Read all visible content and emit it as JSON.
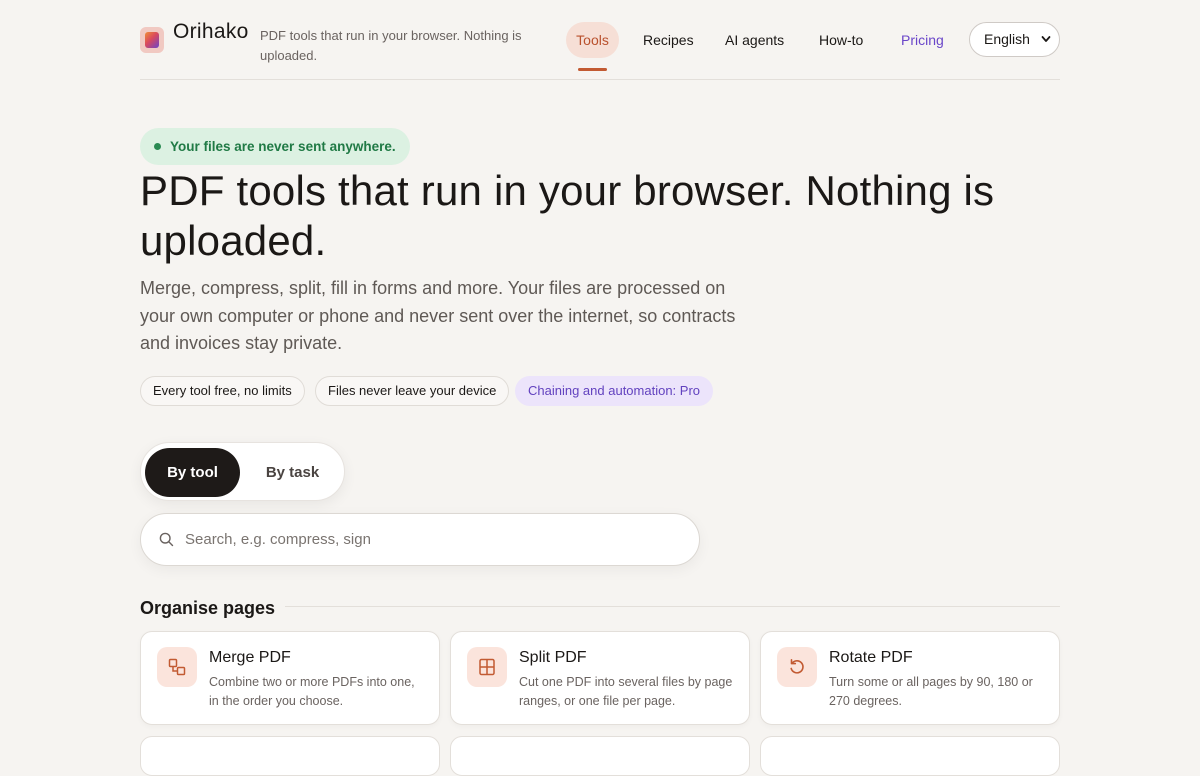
{
  "header": {
    "brand": "Orihako",
    "tagline": "PDF tools that run in your browser. Nothing is uploaded.",
    "nav": {
      "tools": "Tools",
      "recipes": "Recipes",
      "ai_agents": "AI agents",
      "how_to": "How-to",
      "pricing": "Pricing"
    },
    "language": "English"
  },
  "hero": {
    "privacy_badge": "Your files are never sent anywhere.",
    "title": "PDF tools that run in your browser. Nothing is uploaded.",
    "subtitle": "Merge, compress, split, fill in forms and more. Your files are processed on your own computer or phone and never sent over the internet, so contracts and invoices stay private.",
    "chips": [
      "Every tool free, no limits",
      "Files never leave your device",
      "Chaining and automation: Pro"
    ]
  },
  "view_toggle": {
    "by_tool": "By tool",
    "by_task": "By task",
    "selected": "By tool"
  },
  "search": {
    "placeholder": "Search, e.g. compress, sign",
    "value": ""
  },
  "sections": [
    {
      "title": "Organise pages",
      "tools": [
        {
          "name": "Merge PDF",
          "description": "Combine two or more PDFs into one, in the order you choose.",
          "icon": "merge-icon"
        },
        {
          "name": "Split PDF",
          "description": "Cut one PDF into several files by page ranges, or one file per page.",
          "icon": "split-icon"
        },
        {
          "name": "Rotate PDF",
          "description": "Turn some or all pages by 90, 180 or 270 degrees.",
          "icon": "rotate-icon"
        }
      ]
    }
  ],
  "colors": {
    "background": "#f6f4f1",
    "accent": "#c25a32",
    "pro_purple": "#6a46c9",
    "privacy_green": "#207a45"
  }
}
